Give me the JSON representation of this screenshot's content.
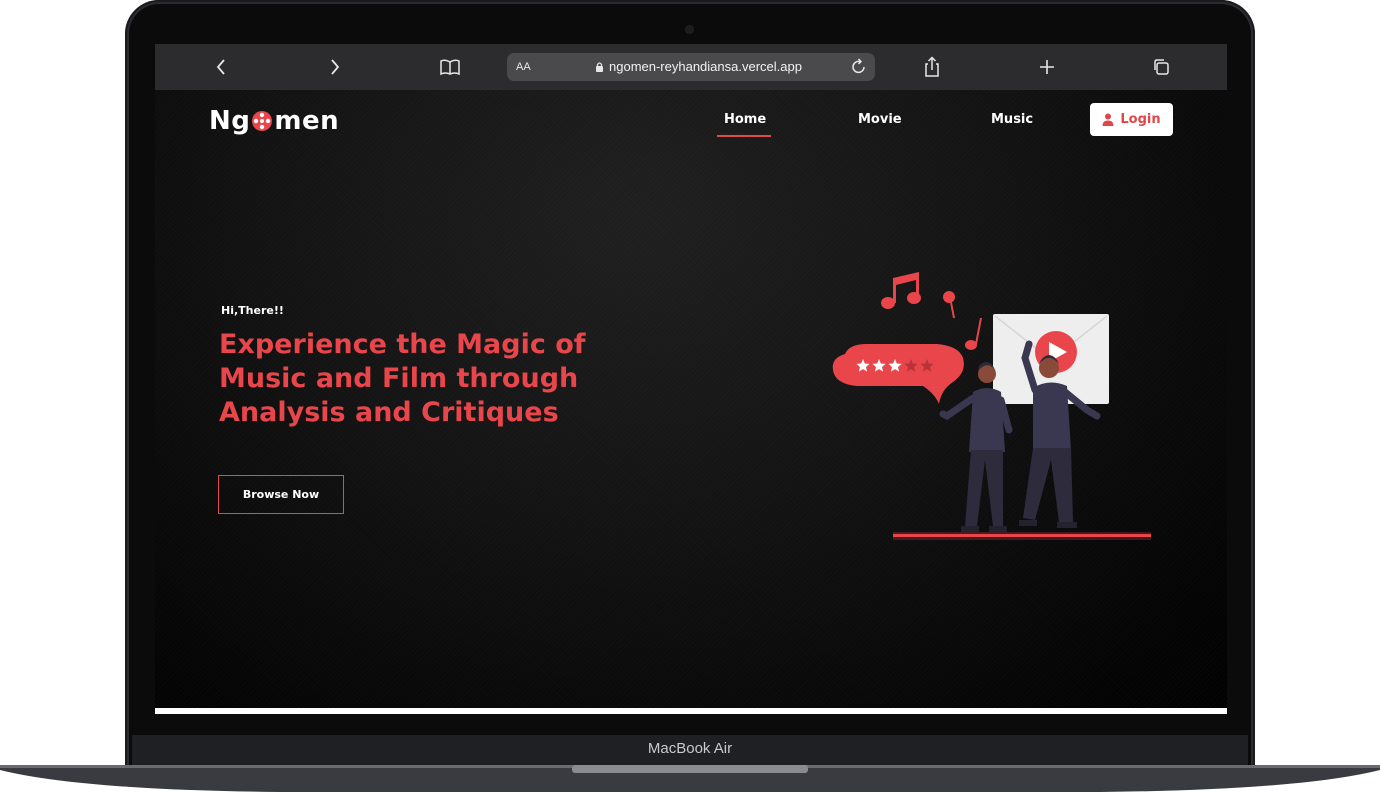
{
  "device": {
    "model_label": "MacBook Air"
  },
  "browser": {
    "address_bar": {
      "text_size_label": "AA",
      "url": "ngomen-reyhandiansa.vercel.app"
    },
    "icons": [
      "chevron-left-icon",
      "chevron-right-icon",
      "book-icon",
      "lock-icon",
      "reload-icon",
      "share-icon",
      "plus-icon",
      "tabs-icon"
    ]
  },
  "site": {
    "logo": {
      "part1": "Ng",
      "part2": "men"
    },
    "nav": [
      {
        "label": "Home",
        "active": true
      },
      {
        "label": "Movie",
        "active": false
      },
      {
        "label": "Music",
        "active": false
      }
    ],
    "login_label": "Login",
    "hero": {
      "greeting": "Hi,There!!",
      "headline_lines": [
        "Experience the Magic of",
        "Music and Film through",
        "Analysis and Critiques"
      ],
      "cta_label": "Browse Now"
    },
    "rating": {
      "filled": 3,
      "total": 5
    }
  },
  "colors": {
    "accent": "#e8464a",
    "background": "#000000",
    "toolbar": "#2c2c2e"
  }
}
